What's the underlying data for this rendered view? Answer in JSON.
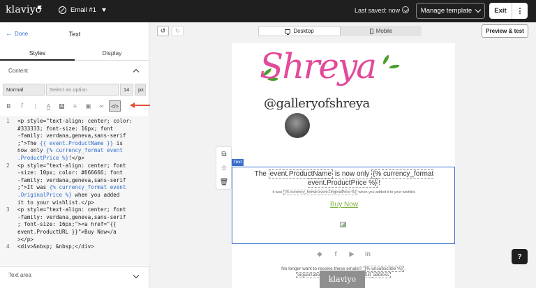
{
  "topbar": {
    "logo": "klaviyo",
    "email_name": "Email #1",
    "saved": "Last saved: now",
    "manage_template": "Manage template",
    "exit": "Exit"
  },
  "left_panel": {
    "back": "Done",
    "title": "Text",
    "tabs": [
      "Styles",
      "Display"
    ],
    "content_section": "Content",
    "format_style": "Normal",
    "font_placeholder": "Select an option",
    "font_size": "14",
    "font_unit": "px",
    "toolbar_icons": [
      "bold-icon",
      "italic-icon",
      "more-icon",
      "text-color-icon",
      "highlight-icon",
      "align-icon",
      "image-icon",
      "link-icon",
      "source-code-icon"
    ],
    "text_area_section": "Text area"
  },
  "code": {
    "lines": [
      {
        "num": "1",
        "rows": [
          "<p style=\"text-align: center; color:",
          "#333333; font-size: 16px; font",
          "-family: verdana,geneva,sans-serif",
          ";\">The {{ event.ProductName }} is",
          "now only {% currency_format event",
          ".ProductPrice %}!</p>"
        ]
      },
      {
        "num": "2",
        "rows": [
          "<p style=\"text-align: center; font",
          "-size: 10px; color: #666666; font",
          "-family: verdana,geneva,sans-serif",
          ";\">It was {% currency_format event",
          ".OriginalPrice %} when you added",
          "it to your wishlist.</p>"
        ]
      },
      {
        "num": "3",
        "rows": [
          "<p style=\"text-align: center; font",
          "-family: verdana,geneva,sans-serif",
          "; font-size: 16px;\"><a href=\"{{",
          "event.ProductURL }}\">Buy Now</a",
          "></p>"
        ]
      },
      {
        "num": "4",
        "rows": [
          "<div>&nbsp; &nbsp;</div>"
        ]
      }
    ]
  },
  "canvas": {
    "desktop": "Desktop",
    "mobile": "Mobile",
    "preview": "Preview & test"
  },
  "email": {
    "brand_script": "Shreya",
    "brand_sub": "@galleryofshreya",
    "text_tag": "Text",
    "line1_a": "The ",
    "line1_tag1": "event.ProductName",
    "line1_b": " is now only ",
    "line1_tag2": "{% currency_format event.ProductPrice %}",
    "line1_c": "!",
    "line2_a": "It was ",
    "line2_tag": "{% currency_format event.OriginalPrice %}",
    "line2_b": " when you added it to your wishlist.",
    "buy_now": "Buy Now",
    "footer_a": "No longer want to receive these emails? ",
    "footer_tag1": "{% unsubscribe %}",
    "footer_b": ".",
    "footer_tag2": "organization.name",
    "footer_tag3": "organization.full_address",
    "badge": "klaviyo"
  },
  "help": "?",
  "colors": {
    "accent_blue": "#3c6fcd",
    "brand_pink": "#e24a9a",
    "link_green": "#7fb03e",
    "arrow_red": "#e2523a"
  }
}
